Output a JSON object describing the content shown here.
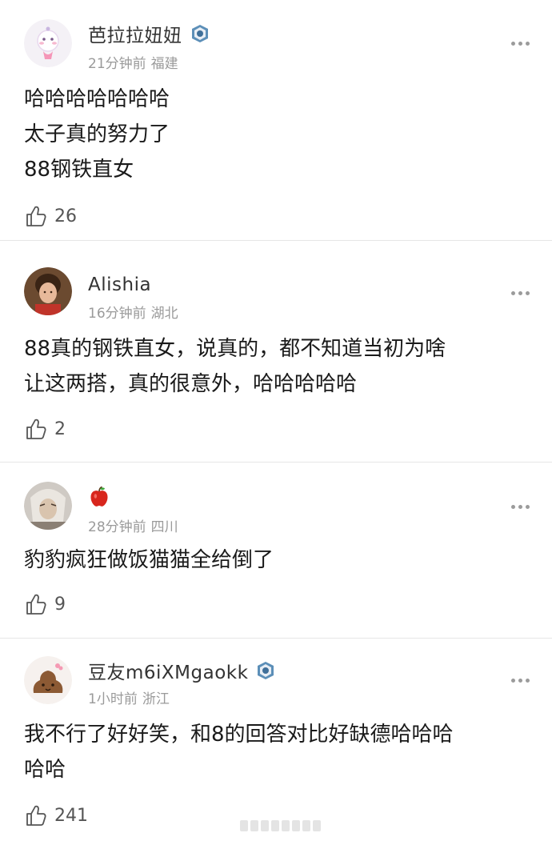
{
  "comments": [
    {
      "username": "芭拉拉妞妞",
      "time": "21分钟前",
      "location": "福建",
      "text": "哈哈哈哈哈哈哈\n太子真的努力了\n88钢铁直女",
      "likes": "26",
      "avatar_icon": "pink-cartoon-avatar-icon",
      "badge_icon": "member-badge-icon"
    },
    {
      "username": "Alishia",
      "time": "16分钟前",
      "location": "湖北",
      "text": "88真的钢铁直女，说真的，都不知道当初为啥\n让这两搭，真的很意外，哈哈哈哈哈",
      "likes": "2",
      "avatar_icon": "photo-avatar-icon"
    },
    {
      "username": "",
      "time": "28分钟前",
      "location": "四川",
      "text": "豹豹疯狂做饭猫猫全给倒了",
      "likes": "9",
      "avatar_icon": "photo-avatar-icon",
      "name_icon": "apple-icon"
    },
    {
      "username": "豆友m6iXMgaokk",
      "time": "1小时前",
      "location": "浙江",
      "text": "我不行了好好笑，和8的回答对比好缺德哈哈哈\n哈哈",
      "likes": "241",
      "avatar_icon": "cartoon-avatar-icon",
      "badge_icon": "member-badge-icon"
    }
  ]
}
